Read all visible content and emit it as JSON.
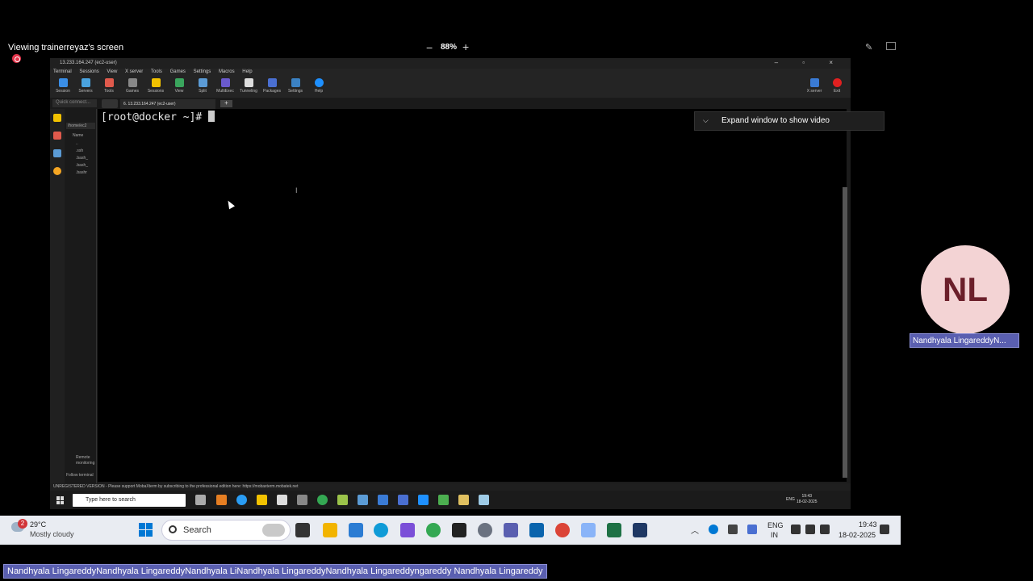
{
  "share_bar": {
    "viewing_label": "Viewing trainerreyaz's screen",
    "zoom_out": "−",
    "zoom_level": "88%",
    "zoom_in": "+"
  },
  "mobaxterm": {
    "window_title": "13.233.164.247 (ec2-user)",
    "window_controls": "– ▫ ×",
    "menu": [
      "Terminal",
      "Sessions",
      "View",
      "X server",
      "Tools",
      "Games",
      "Settings",
      "Macros",
      "Help"
    ],
    "toolbar": [
      "Session",
      "Servers",
      "Tools",
      "Games",
      "Sessions",
      "View",
      "Split",
      "MultiExec",
      "Tunneling",
      "Packages",
      "Settings",
      "Help"
    ],
    "toolbar_right": [
      "X server",
      "Exit"
    ],
    "quick_connect": "Quick connect...",
    "session_tab": "6. 13.233.164.247 (ec2-user)",
    "sftp_path": "/home/ec2",
    "sftp_header": "Name",
    "sftp_items": [
      "..",
      ".ssh",
      ".bash_",
      ".bash_",
      ".bashr"
    ],
    "sftp_footer": [
      "Remote monitoring",
      "Follow terminal"
    ],
    "prompt": "[root@docker ~]# ",
    "status_text": "UNREGISTERED VERSION  -  Please support MobaXterm by subscribing to the professional edition here:  https://mobaxterm.mobatek.net"
  },
  "inner_taskbar": {
    "search_placeholder": "Type here to search",
    "lang": "ENG",
    "time": "19:43",
    "date": "18-02-2025"
  },
  "expand_banner": {
    "label": "Expand window to show video"
  },
  "participant": {
    "initials": "NL",
    "name": "Nandhyala LingareddyN..."
  },
  "taskbar": {
    "weather_badge": "2",
    "weather_temp": "29°C",
    "weather_desc": "Mostly cloudy",
    "search_label": "Search",
    "lang_top": "ENG",
    "lang_bottom": "IN",
    "time": "19:43",
    "date": "18-02-2025"
  },
  "caption": "Nandhyala LingareddyNandhyala LingareddyNandhyala LiNandhyala LingareddyNandhyala Lingareddyngareddy Nandhyala Lingareddy",
  "colors": {
    "teams_accent": "#5a5fb0",
    "avatar_bg": "#f3d3d4",
    "avatar_fg": "#6b1f2a",
    "recording": "#e0334a"
  }
}
